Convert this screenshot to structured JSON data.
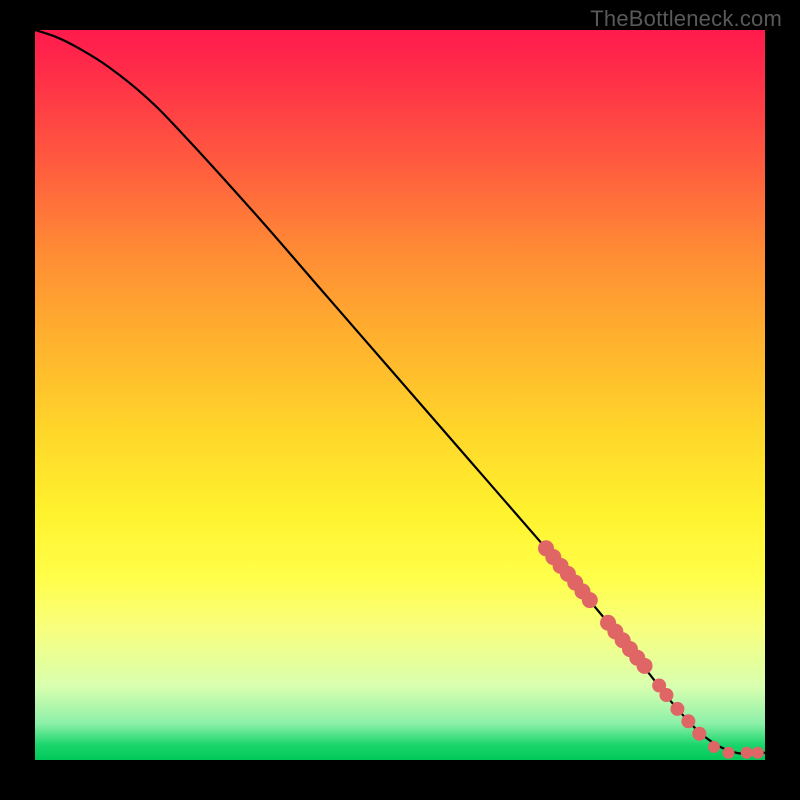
{
  "attribution": "TheBottleneck.com",
  "colors": {
    "marker": "#e06666",
    "curve": "#000000",
    "background_top": "#ff1a4d",
    "background_bottom": "#00c859",
    "page": "#000000"
  },
  "chart_data": {
    "type": "line",
    "title": "",
    "xlabel": "",
    "ylabel": "",
    "xlim": [
      0,
      100
    ],
    "ylim": [
      0,
      100
    ],
    "grid": false,
    "legend": false,
    "series": [
      {
        "name": "curve",
        "x": [
          0,
          3,
          6,
          10,
          15,
          20,
          30,
          40,
          50,
          60,
          70,
          75,
          80,
          84,
          88,
          92,
          96,
          100
        ],
        "y": [
          100,
          99,
          97.5,
          95,
          91,
          86,
          75,
          63.5,
          52,
          40.5,
          29,
          23,
          17,
          12,
          7,
          3,
          1,
          1
        ]
      }
    ],
    "markers": [
      {
        "x": 70.0,
        "y": 29.0
      },
      {
        "x": 71.0,
        "y": 27.8
      },
      {
        "x": 72.0,
        "y": 26.6
      },
      {
        "x": 73.0,
        "y": 25.5
      },
      {
        "x": 74.0,
        "y": 24.3
      },
      {
        "x": 75.0,
        "y": 23.1
      },
      {
        "x": 76.0,
        "y": 21.9
      },
      {
        "x": 78.5,
        "y": 18.8
      },
      {
        "x": 79.5,
        "y": 17.6
      },
      {
        "x": 80.5,
        "y": 16.4
      },
      {
        "x": 81.5,
        "y": 15.2
      },
      {
        "x": 82.5,
        "y": 14.0
      },
      {
        "x": 83.5,
        "y": 12.9
      },
      {
        "x": 85.5,
        "y": 10.2
      },
      {
        "x": 86.5,
        "y": 8.9
      },
      {
        "x": 88.0,
        "y": 7.0
      },
      {
        "x": 89.5,
        "y": 5.3
      },
      {
        "x": 91.0,
        "y": 3.6
      },
      {
        "x": 93.0,
        "y": 1.8
      },
      {
        "x": 95.0,
        "y": 1.0
      },
      {
        "x": 97.5,
        "y": 1.0
      },
      {
        "x": 99.0,
        "y": 1.0
      }
    ],
    "marker_radii": [
      8,
      8,
      8,
      8,
      8,
      8,
      8,
      8,
      8,
      8,
      8,
      8,
      8,
      7,
      7,
      7,
      7,
      7,
      6,
      6,
      6,
      6
    ]
  }
}
